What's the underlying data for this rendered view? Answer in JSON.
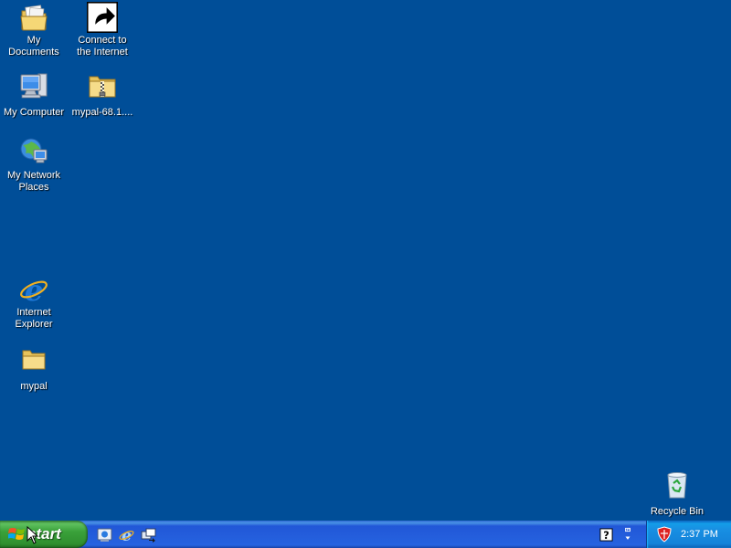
{
  "desktop": {
    "background_color": "#004e98",
    "icons": {
      "my_documents": {
        "label": "My Documents",
        "icon": "my-documents-icon"
      },
      "connect_internet": {
        "label": "Connect to the Internet",
        "icon": "connect-to-internet-icon"
      },
      "my_computer": {
        "label": "My Computer",
        "icon": "my-computer-icon"
      },
      "mypal_zip": {
        "label": "mypal-68.1....",
        "icon": "zip-folder-icon"
      },
      "my_network": {
        "label": "My Network Places",
        "icon": "network-places-icon"
      },
      "internet_explorer": {
        "label": "Internet Explorer",
        "icon": "internet-explorer-icon"
      },
      "mypal_folder": {
        "label": "mypal",
        "icon": "folder-icon"
      },
      "recycle_bin": {
        "label": "Recycle Bin",
        "icon": "recycle-bin-icon"
      }
    }
  },
  "taskbar": {
    "start_label": "start",
    "quick_launch": [
      "show-desktop-icon",
      "internet-explorer-icon",
      "switch-windows-icon"
    ],
    "tray": {
      "clock": "2:37 PM",
      "icons": [
        "help-icon",
        "network-connection-icon",
        "security-center-icon"
      ]
    }
  }
}
